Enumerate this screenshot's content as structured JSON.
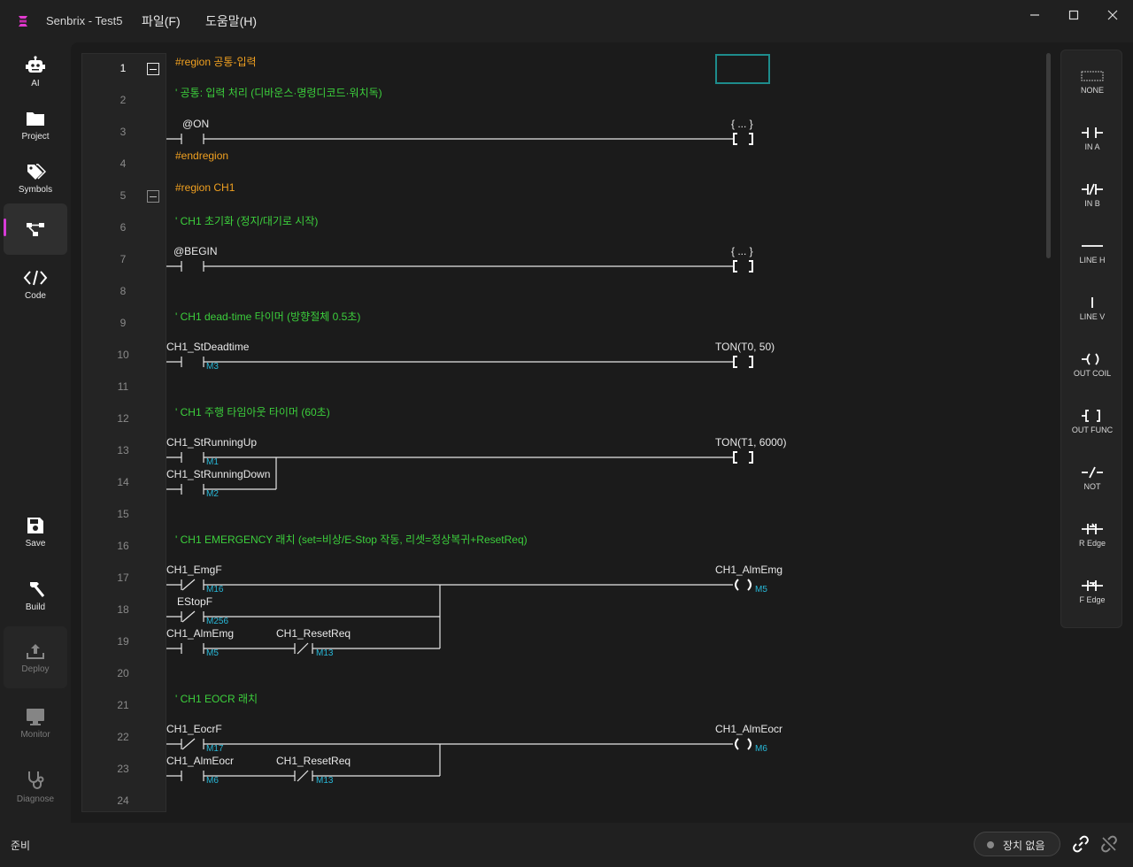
{
  "app": {
    "title": "Senbrix - Test5",
    "menus": [
      "파일(F)",
      "도움말(H)"
    ]
  },
  "window_controls": [
    "minimize-icon",
    "maximize-icon",
    "close-icon"
  ],
  "nav": {
    "items": [
      {
        "label": "AI",
        "icon": "robot-icon"
      },
      {
        "label": "Project",
        "icon": "folder-icon"
      },
      {
        "label": "Symbols",
        "icon": "tags-icon"
      },
      {
        "label": "",
        "icon": "ladder-diagram-icon",
        "active": true
      },
      {
        "label": "Code",
        "icon": "code-icon"
      }
    ],
    "bottom_items": [
      {
        "label": "Save",
        "icon": "save-icon"
      },
      {
        "label": "Build",
        "icon": "hammer-icon"
      },
      {
        "label": "Deploy",
        "icon": "upload-icon",
        "disabled": true
      },
      {
        "label": "Monitor",
        "icon": "monitor-icon",
        "disabled": true
      },
      {
        "label": "Diagnose",
        "icon": "stethoscope-icon",
        "disabled": true
      }
    ]
  },
  "editor": {
    "current_line": 1,
    "line_numbers": [
      "1",
      "2",
      "3",
      "4",
      "5",
      "6",
      "7",
      "8",
      "9",
      "10",
      "11",
      "12",
      "13",
      "14",
      "15",
      "16",
      "17",
      "18",
      "19",
      "20",
      "21",
      "22",
      "23",
      "24"
    ],
    "regions": {
      "r1_start": "#region 공통-입력",
      "r1_end": "#endregion",
      "r2_start": "#region CH1"
    },
    "comments": {
      "c2": "' 공통: 입력 처리 (디바운스·명령디코드·워치독)",
      "c6": "' CH1 초기화 (정지/대기로 시작)",
      "c9": "' CH1 dead-time 타이머 (방향절체 0.5초)",
      "c12": "' CH1 주행 타임아웃 타이머 (60초)",
      "c16": "' CH1 EMERGENCY 래치 (set=비상/E-Stop 작동, 리셋=정상복귀+ResetReq)",
      "c21": "' CH1 EOCR 래치"
    },
    "contacts": {
      "l3": "@ON",
      "l7": "@BEGIN",
      "l10": "CH1_StDeadtime",
      "l13": "CH1_StRunningUp",
      "l14": "CH1_StRunningDown",
      "l17": "CH1_EmgF",
      "l18": "EStopF",
      "l19a": "CH1_AlmEmg",
      "l19b": "CH1_ResetReq",
      "l22": "CH1_EocrF",
      "l23a": "CH1_AlmEocr",
      "l23b": "CH1_ResetReq"
    },
    "addresses": {
      "l10": "M3",
      "l13": "M1",
      "l14": "M2",
      "l17": "M16",
      "l18": "M256",
      "l19a": "M5",
      "l19b": "M13",
      "l17out": "M5",
      "l22": "M17",
      "l23a": "M6",
      "l23b": "M13",
      "l22out": "M6"
    },
    "outputs": {
      "l3": "{ ... }",
      "l7": "{ ... }",
      "l10": "TON(T0, 50)",
      "l13": "TON(T1, 6000)",
      "l17": "CH1_AlmEmg",
      "l22": "CH1_AlmEocr"
    }
  },
  "palette": [
    {
      "label": "NONE",
      "icon": "none-icon"
    },
    {
      "label": "IN A",
      "icon": "contact-a-icon"
    },
    {
      "label": "IN B",
      "icon": "contact-b-icon"
    },
    {
      "label": "LINE H",
      "icon": "line-h-icon"
    },
    {
      "label": "LINE V",
      "icon": "line-v-icon"
    },
    {
      "label": "OUT COIL",
      "icon": "coil-icon"
    },
    {
      "label": "OUT FUNC",
      "icon": "func-icon"
    },
    {
      "label": "NOT",
      "icon": "not-icon"
    },
    {
      "label": "R Edge",
      "icon": "rising-edge-icon"
    },
    {
      "label": "F Edge",
      "icon": "falling-edge-icon"
    }
  ],
  "status": {
    "text": "준비",
    "device": "장치 없음"
  },
  "colors": {
    "region": "#f0a020",
    "comment": "#3ccf3c",
    "address": "#28b8d8",
    "accent": "#d63bd6"
  }
}
